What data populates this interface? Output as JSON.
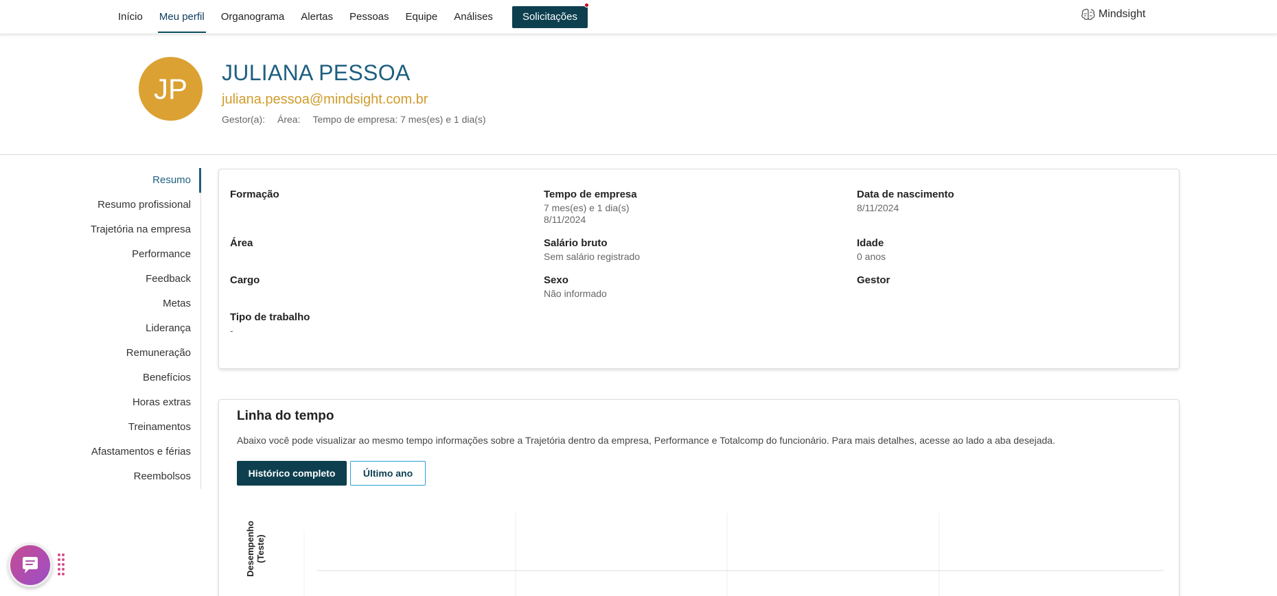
{
  "nav": {
    "items": [
      "Início",
      "Meu perfil",
      "Organograma",
      "Alertas",
      "Pessoas",
      "Equipe",
      "Análises"
    ],
    "active": "Meu perfil",
    "cta": "Solicitações",
    "logo": "Mindsight"
  },
  "profile": {
    "initials": "JP",
    "name": "JULIANA PESSOA",
    "email": "juliana.pessoa@mindsight.com.br",
    "manager_label": "Gestor(a):",
    "area_label": "Área:",
    "tenure": "Tempo de empresa: 7 mes(es) e 1 dia(s)",
    "avatar_color": "#dba133"
  },
  "sidebar": {
    "items": [
      "Resumo",
      "Resumo profissional",
      "Trajetória na empresa",
      "Performance",
      "Feedback",
      "Metas",
      "Liderança",
      "Remuneração",
      "Benefícios",
      "Horas extras",
      "Treinamentos",
      "Afastamentos e férias",
      "Reembolsos"
    ],
    "active": "Resumo"
  },
  "summary": {
    "formacao": {
      "label": "Formação"
    },
    "tempo": {
      "label": "Tempo de empresa",
      "value": "7 mes(es) e 1 dia(s)",
      "value2": "8/11/2024"
    },
    "nascimento": {
      "label": "Data de nascimento",
      "value": "8/11/2024"
    },
    "area": {
      "label": "Área"
    },
    "salario": {
      "label": "Salário bruto",
      "value": "Sem salário registrado"
    },
    "idade": {
      "label": "Idade",
      "value": "0 anos"
    },
    "cargo": {
      "label": "Cargo"
    },
    "sexo": {
      "label": "Sexo",
      "value": "Não informado"
    },
    "gestor": {
      "label": "Gestor"
    },
    "tipo": {
      "label": "Tipo de trabalho",
      "value": "-"
    }
  },
  "timeline": {
    "title": "Linha do tempo",
    "description": "Abaixo você pode visualizar ao mesmo tempo informações sobre a Trajetória dentro da empresa, Performance e Totalcomp do funcionário. Para mais detalhes, acesse ao lado a aba desejada.",
    "btn_full": "Histórico completo",
    "btn_year": "Último ano",
    "y_label_1": "Desempenho",
    "y_label_2": "(Teste)"
  },
  "colors": {
    "primary": "#0d3f4f",
    "accent": "#1e5f80",
    "email": "#d09b2c",
    "notification": "#d0021b"
  },
  "icons": [
    "brain-logo-icon",
    "chat-icon",
    "drag-grip-icon"
  ]
}
